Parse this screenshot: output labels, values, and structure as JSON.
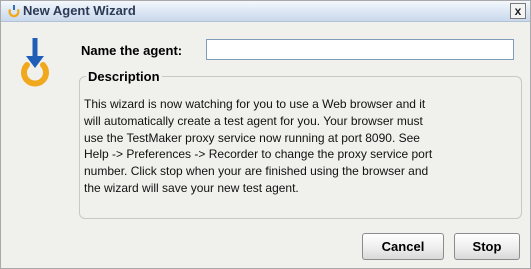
{
  "window": {
    "title": "New Agent Wizard",
    "close_label": "x",
    "icon": "wizard-icon"
  },
  "form": {
    "name_label": "Name the agent:",
    "name_value": ""
  },
  "description": {
    "title": "Description",
    "lines": [
      "This wizard is now watching for you to use a Web browser and it",
      "will automatically create a test agent for you. Your browser must",
      "use the TestMaker proxy service now running at port 8090. See",
      "Help -> Preferences -> Recorder to change the proxy service port",
      "number. Click stop when your are finished using the browser and",
      "the wizard will save your new test agent."
    ]
  },
  "buttons": {
    "cancel_label": "Cancel",
    "stop_label": "Stop"
  },
  "colors": {
    "icon_arrow": "#1f5fb8",
    "icon_ring": "#f0a81c",
    "title_text": "#2b3a55"
  }
}
